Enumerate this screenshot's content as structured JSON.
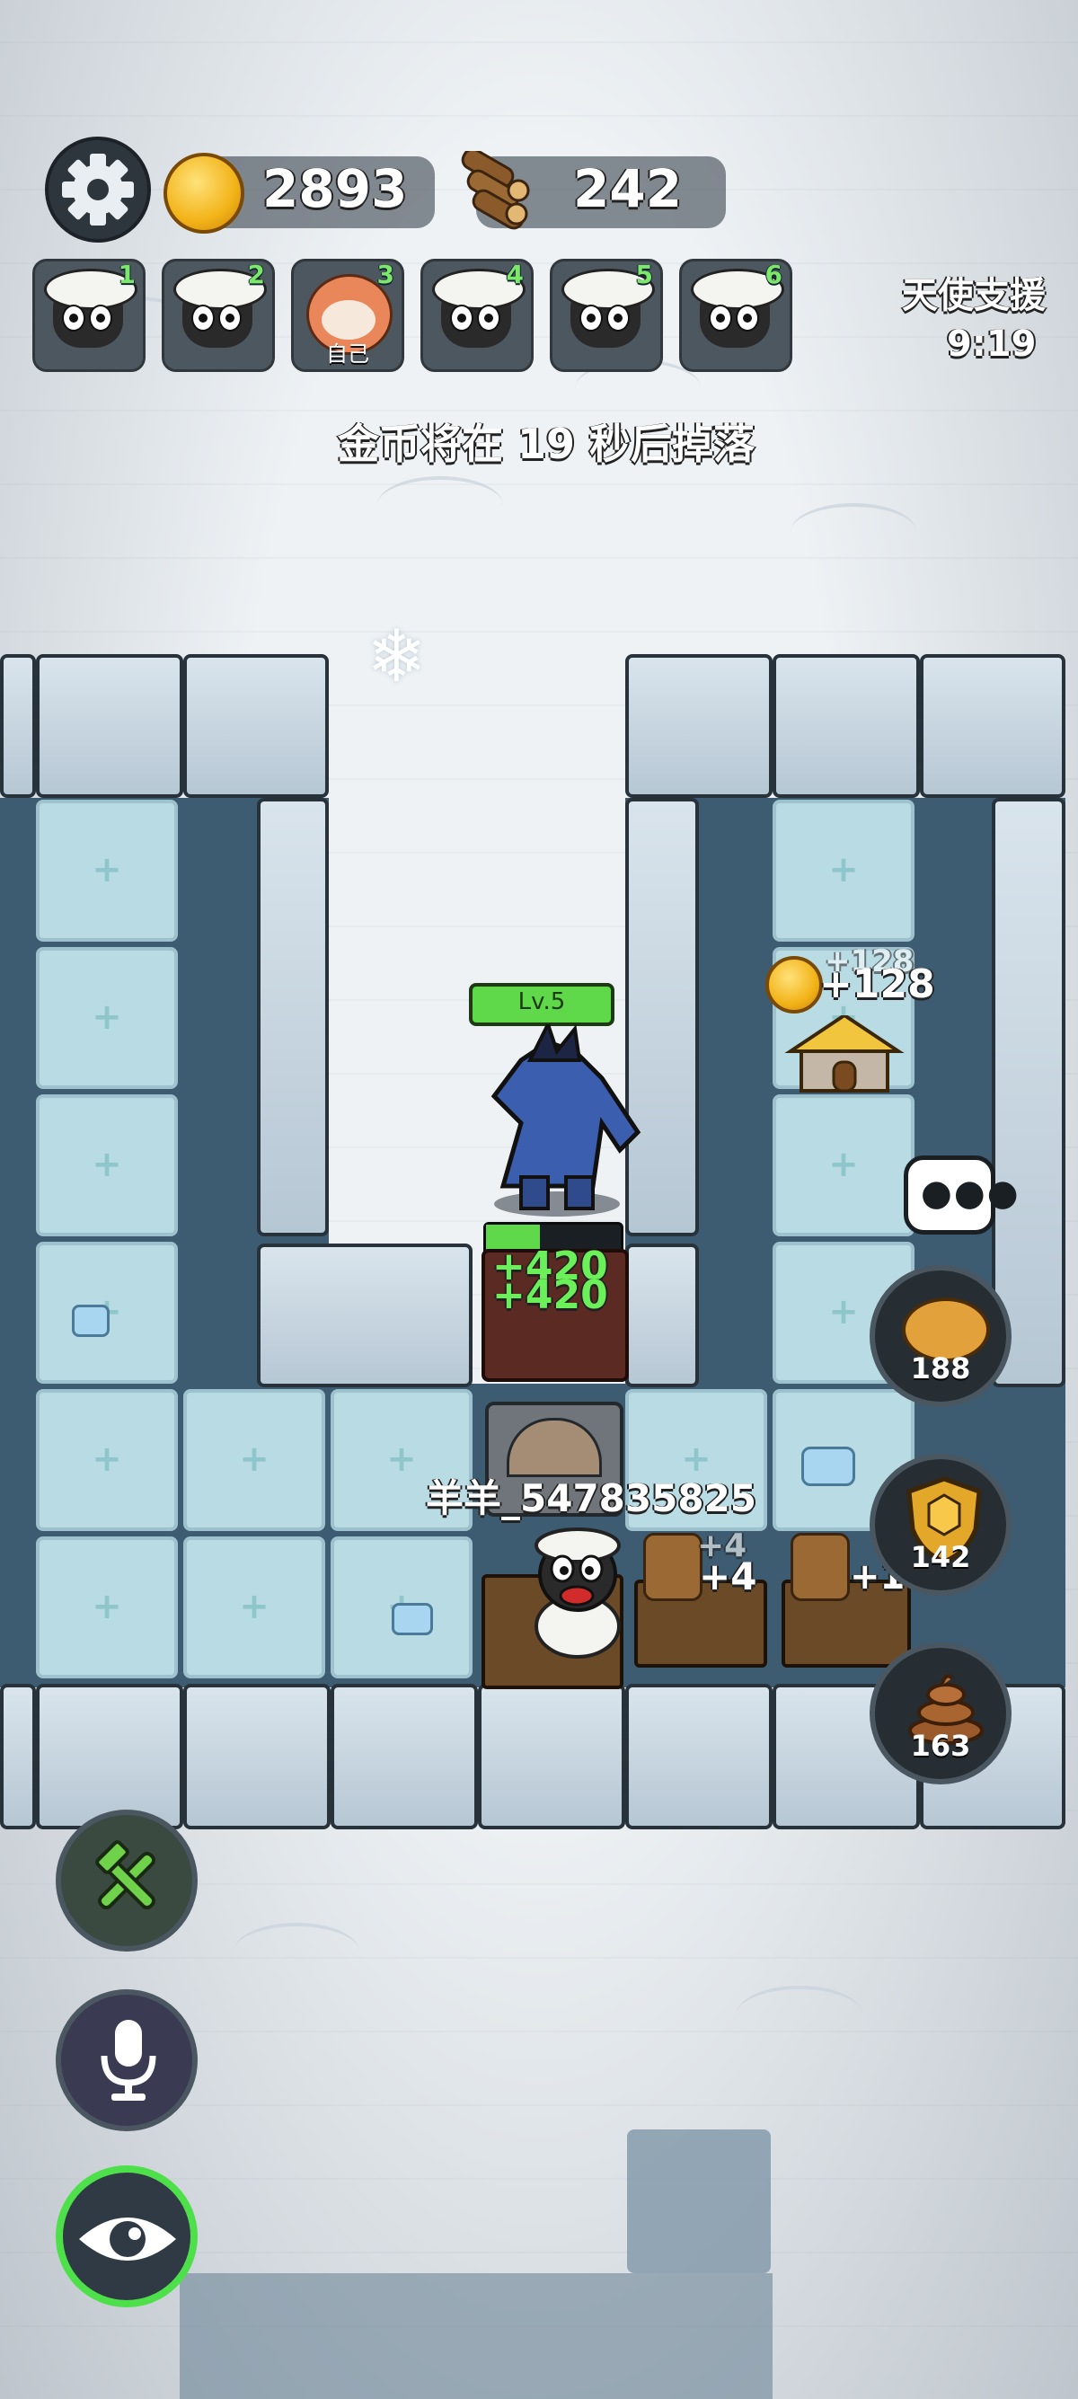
{
  "resources": {
    "coins": "2893",
    "wood": "242"
  },
  "players": [
    {
      "num": "1",
      "tag": ""
    },
    {
      "num": "2",
      "tag": ""
    },
    {
      "num": "3",
      "tag": "自己"
    },
    {
      "num": "4",
      "tag": ""
    },
    {
      "num": "5",
      "tag": ""
    },
    {
      "num": "6",
      "tag": ""
    }
  ],
  "angel_support": {
    "label": "天使支援",
    "timer": "9:19"
  },
  "notice": "金币将在 19 秒后掉落",
  "monster": {
    "level": "Lv.5",
    "damage_1": "+420",
    "damage_2": "+420"
  },
  "house_income": {
    "ghost": "+128",
    "main": "+128"
  },
  "player_name": "羊羊_547835825",
  "wood_income": {
    "ghost": "+4",
    "main": "+4",
    "second": "+1"
  },
  "side_buttons": {
    "piggy_bank": "188",
    "shield": "142",
    "poop": "163"
  },
  "colors": {
    "accent_green": "#5fd84a",
    "panel_dark": "#262d33",
    "floor_ice": "#b9dbe4"
  }
}
